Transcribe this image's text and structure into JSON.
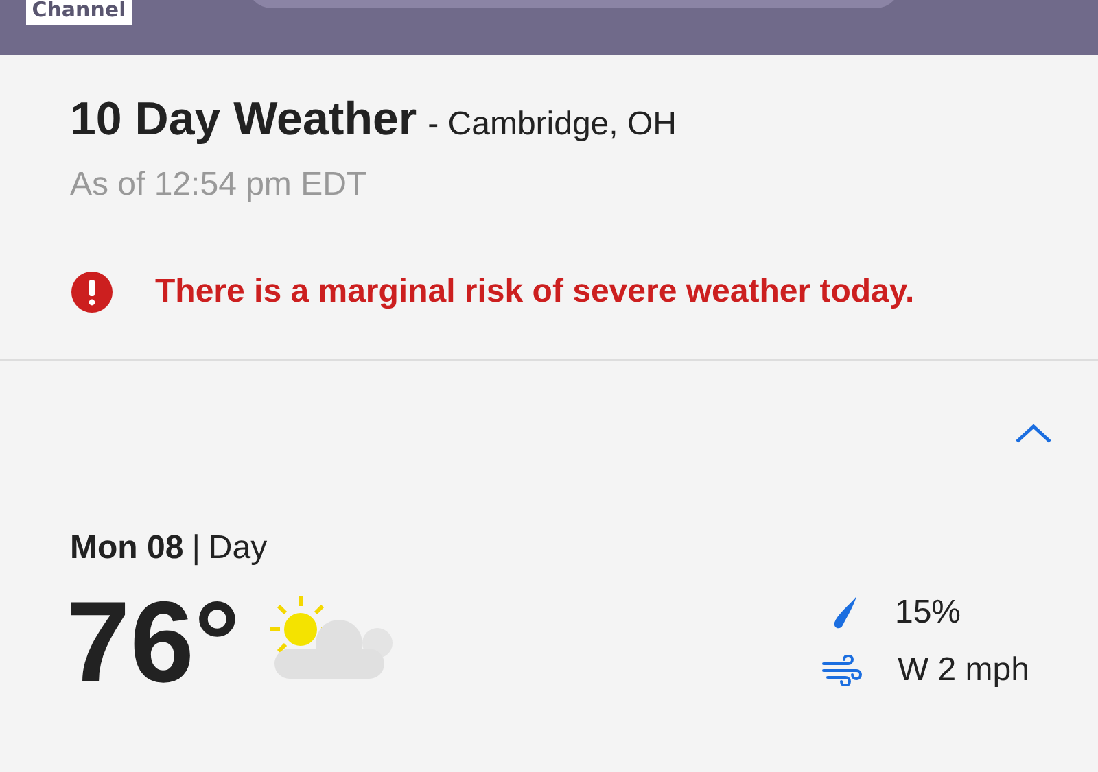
{
  "header": {
    "logo": "Channel"
  },
  "title": "10 Day Weather",
  "location": "- Cambridge, OH",
  "as_of": "As of 12:54 pm EDT",
  "alert": {
    "text": "There is a marginal risk of severe weather today."
  },
  "day": {
    "expanded": true,
    "date": "Mon 08",
    "separator": "|",
    "part": "Day",
    "temperature": "76°",
    "precip": "15%",
    "wind": "W 2 mph"
  }
}
